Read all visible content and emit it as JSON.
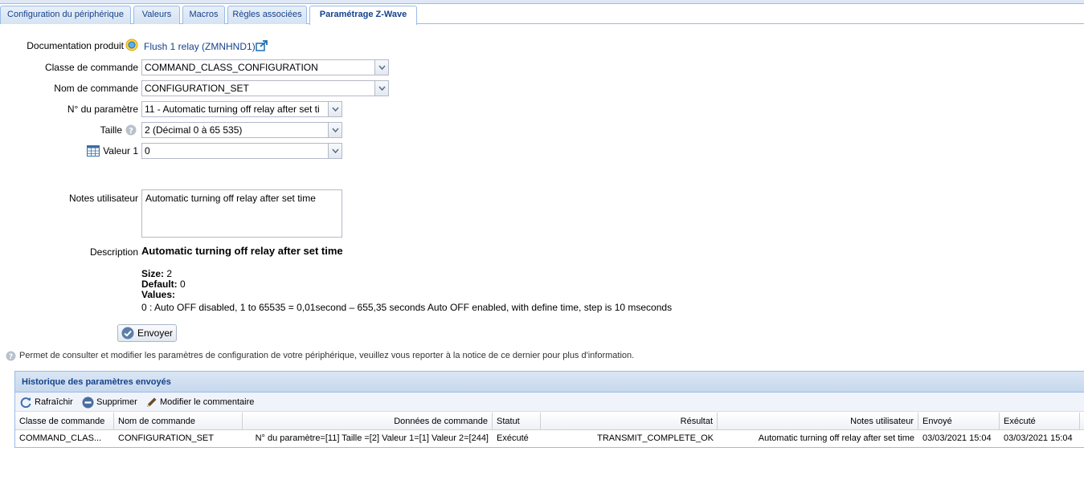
{
  "tabs": [
    {
      "label": "Configuration du périphérique",
      "active": false
    },
    {
      "label": "Valeurs",
      "active": false
    },
    {
      "label": "Macros",
      "active": false
    },
    {
      "label": "Règles associées",
      "active": false
    },
    {
      "label": "Paramétrage Z-Wave",
      "active": true
    }
  ],
  "form": {
    "doc_label": "Documentation produit",
    "doc_link": "Flush 1 relay (ZMNHND1)",
    "command_class_label": "Classe de commande",
    "command_class_value": "COMMAND_CLASS_CONFIGURATION",
    "command_name_label": "Nom de commande",
    "command_name_value": "CONFIGURATION_SET",
    "param_label": "N° du paramètre",
    "param_value": "11 - Automatic turning off relay after set ti",
    "size_label": "Taille",
    "size_value": "2 (Décimal 0 à 65 535)",
    "value1_label": "Valeur 1",
    "value1_value": "0",
    "notes_label": "Notes utilisateur",
    "notes_value": "Automatic turning off relay after set time",
    "description_label": "Description",
    "description_title": "Automatic turning off relay after set time",
    "size_key": "Size:",
    "size_val": "2",
    "default_key": "Default:",
    "default_val": "0",
    "values_key": "Values:",
    "values_text": "0 : Auto OFF disabled, 1 to 65535 = 0,01second – 655,35 seconds Auto OFF enabled, with define time, step is 10 mseconds",
    "send_button": "Envoyer",
    "hint": "Permet de consulter et modifier les paramètres de configuration de votre périphérique, veuillez vous reporter à la notice de ce dernier pour plus d'information."
  },
  "history": {
    "title": "Historique des paramètres envoyés",
    "toolbar": {
      "refresh": "Rafraîchir",
      "delete": "Supprimer",
      "edit_comment": "Modifier le commentaire"
    },
    "columns": [
      "Classe de commande",
      "Nom de commande",
      "Données de commande",
      "Statut",
      "Résultat",
      "Notes utilisateur",
      "Envoyé",
      "Exécuté"
    ],
    "rows": [
      [
        "COMMAND_CLAS...",
        "CONFIGURATION_SET",
        "N° du paramètre=[11] Taille =[2] Valeur 1=[1] Valeur 2=[244]",
        "Exécuté",
        "TRANSMIT_COMPLETE_OK",
        "Automatic turning off relay after set time",
        "03/03/2021 15:04",
        "03/03/2021 15:04"
      ]
    ]
  },
  "icons": {
    "doc": "search-globe-icon",
    "external": "external-link-icon",
    "help": "help-icon",
    "grid": "table-icon",
    "check": "check-circle-icon",
    "refresh": "refresh-icon",
    "delete": "minus-circle-icon",
    "edit": "pencil-icon"
  }
}
